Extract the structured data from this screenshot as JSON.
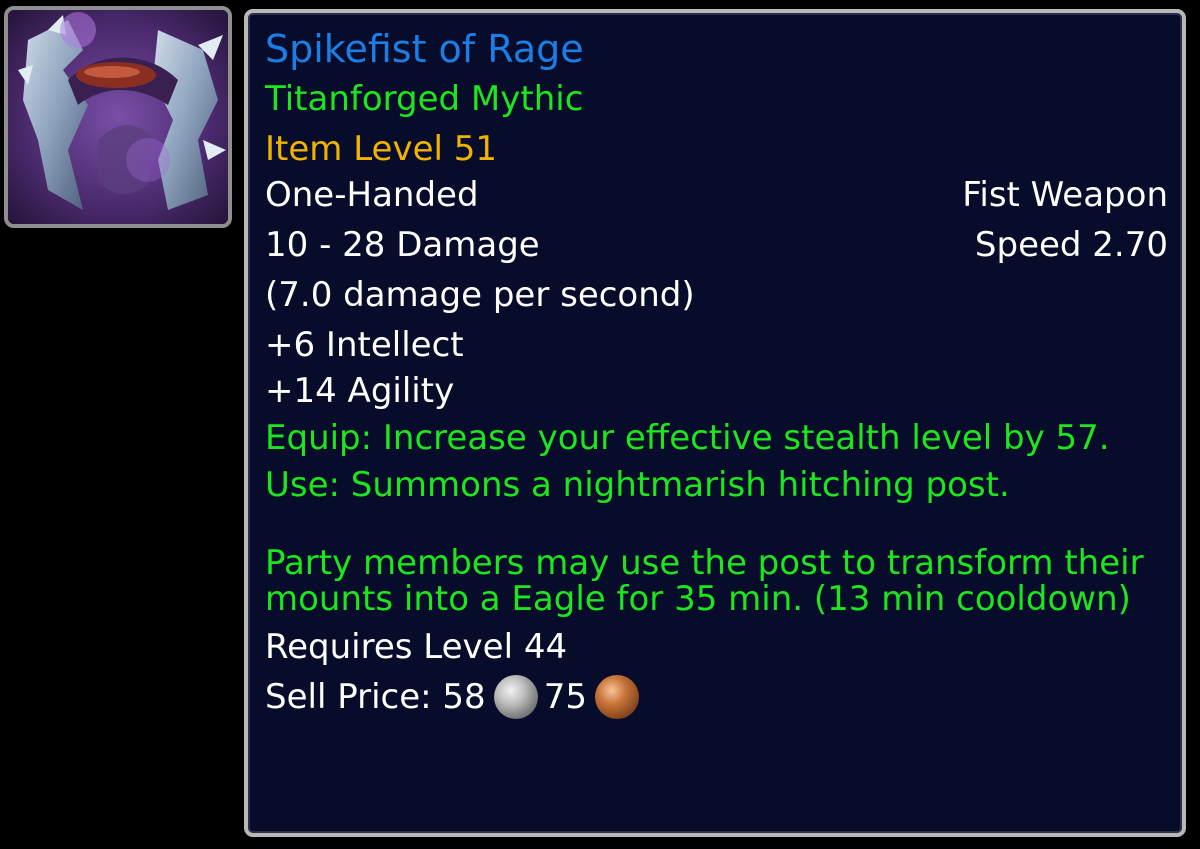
{
  "item": {
    "name": "Spikefist of Rage",
    "quality": "Titanforged Mythic",
    "item_level": "Item Level 51",
    "hand": "One-Handed",
    "weapon_type": "Fist Weapon",
    "damage": "10 - 28 Damage",
    "speed": "Speed 2.70",
    "dps": "(7.0 damage per second)",
    "stats": [
      "+6 Intellect",
      "+14 Agility"
    ],
    "equip": "Equip: Increase your effective stealth level by 57.",
    "use": "Use: Summons a nightmarish hitching post.",
    "use_detail": "Party members may use the post to transform their mounts into a Eagle for 35 min. (13 min cooldown)",
    "requires": "Requires Level 44",
    "sell_label": "Sell Price:",
    "sell_silver": "58",
    "sell_copper": "75"
  },
  "icons": {
    "item": "fist-weapon-icon",
    "silver": "silver-coin-icon",
    "copper": "copper-coin-icon"
  },
  "colors": {
    "title": "#1a7ee6",
    "quality": "#1ee61e",
    "item_level": "#f0b400",
    "text": "#ffffff",
    "effect": "#1ee61e",
    "background": "#060c2a"
  }
}
